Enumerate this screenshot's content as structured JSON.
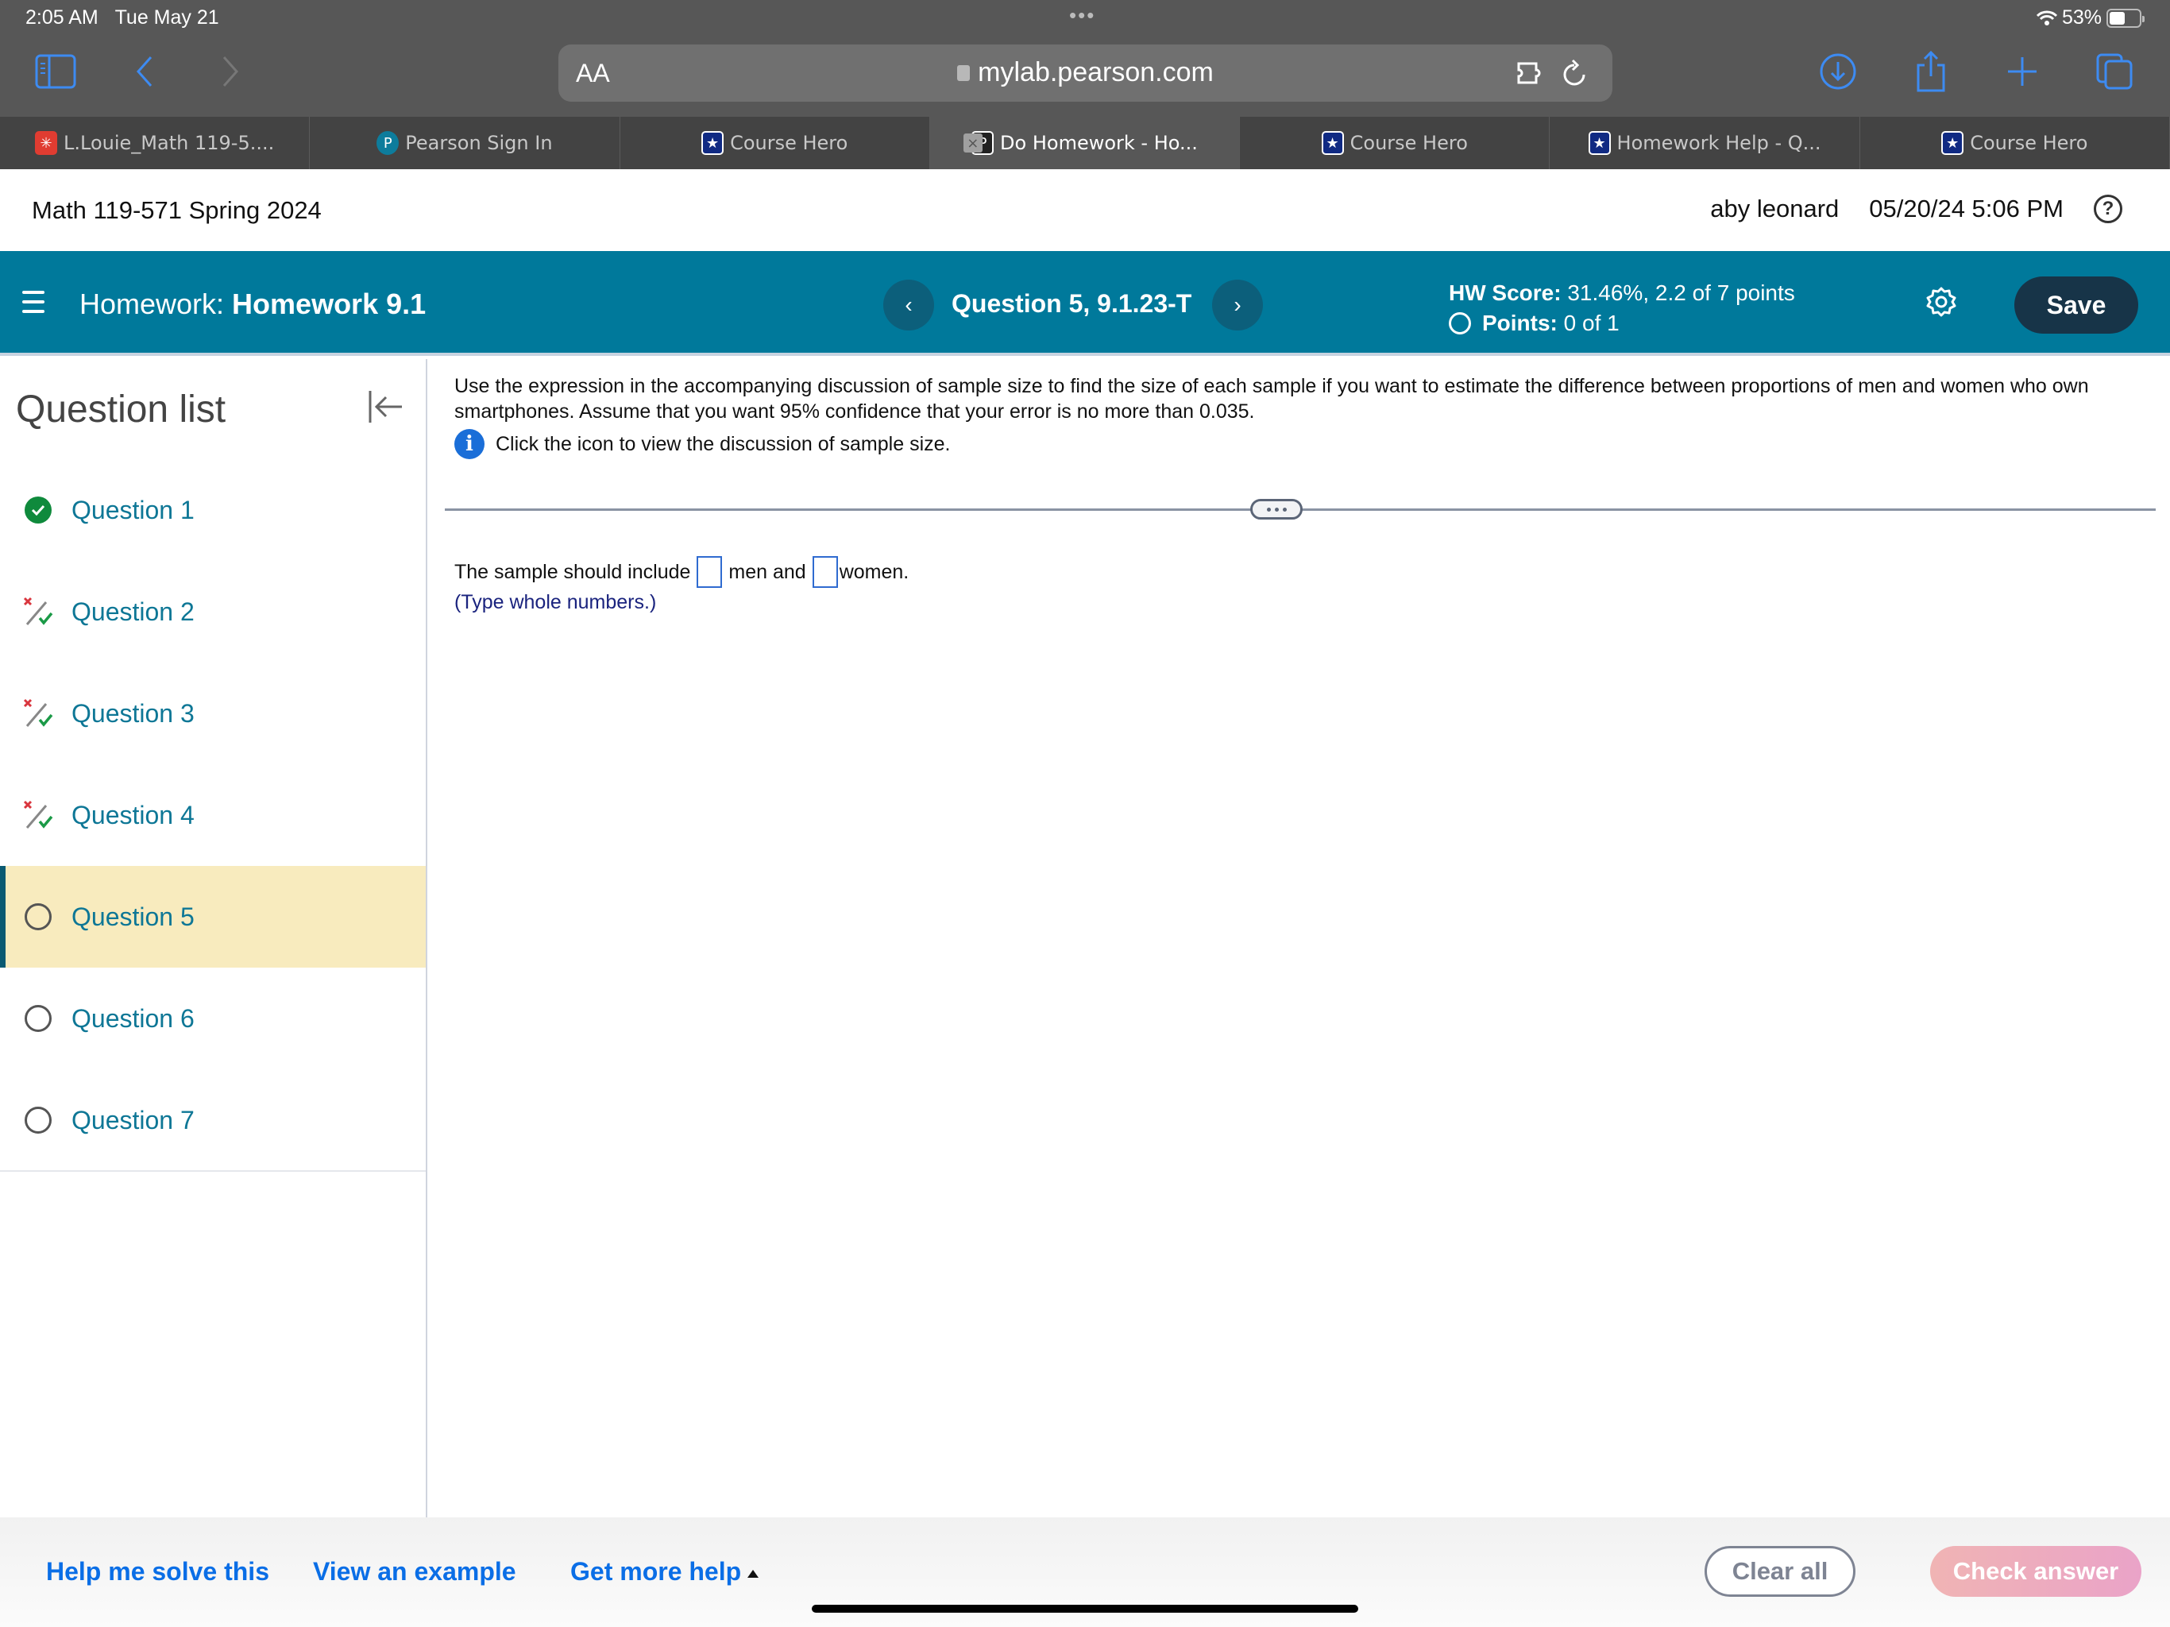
{
  "status_bar": {
    "time": "2:05 AM",
    "date": "Tue May 21",
    "battery": "53%",
    "battery_level": 0.53
  },
  "browser": {
    "text_size_label": "AA",
    "url": "mylab.pearson.com",
    "tabs": [
      {
        "label": "L.Louie_Math 119-5....",
        "icon": "canvas-icon",
        "active": false
      },
      {
        "label": "Pearson Sign In",
        "icon": "pearson-icon",
        "active": false
      },
      {
        "label": "Course Hero",
        "icon": "course-hero-icon",
        "active": false
      },
      {
        "label": "Do Homework - Ho...",
        "icon": "pearson-p-icon",
        "active": true
      },
      {
        "label": "Course Hero",
        "icon": "course-hero-icon",
        "active": false
      },
      {
        "label": "Homework Help - Q...",
        "icon": "course-hero-icon",
        "active": false
      },
      {
        "label": "Course Hero",
        "icon": "course-hero-icon",
        "active": false
      }
    ]
  },
  "course": {
    "title": "Math 119-571 Spring 2024",
    "user": "aby leonard",
    "datetime": "05/20/24 5:06 PM"
  },
  "hw_bar": {
    "prefix": "Homework:",
    "name": "Homework 9.1",
    "question_label": "Question 5, 9.1.23-T",
    "hw_score_label": "HW Score:",
    "hw_score_value": "31.46%, 2.2 of 7 points",
    "points_label": "Points:",
    "points_value": "0 of 1",
    "save_label": "Save"
  },
  "sidebar": {
    "title": "Question list",
    "items": [
      {
        "label": "Question 1",
        "status": "correct"
      },
      {
        "label": "Question 2",
        "status": "partial"
      },
      {
        "label": "Question 3",
        "status": "partial"
      },
      {
        "label": "Question 4",
        "status": "partial"
      },
      {
        "label": "Question 5",
        "status": "unanswered",
        "current": true
      },
      {
        "label": "Question 6",
        "status": "unanswered"
      },
      {
        "label": "Question 7",
        "status": "unanswered"
      }
    ]
  },
  "question": {
    "text": "Use the expression in the accompanying discussion of sample size to find the size of each sample if you want to estimate the difference between proportions of men and women who own smartphones. Assume that you want 95% confidence that your error is no more than 0.035.",
    "info_text": "Click the icon to view the discussion of sample size.",
    "answer_prefix": "The sample should include",
    "answer_mid": "men and",
    "answer_suffix": "women.",
    "men_value": "",
    "women_value": "",
    "hint": "(Type whole numbers.)"
  },
  "footer": {
    "help_me_solve": "Help me solve this",
    "view_example": "View an example",
    "get_more_help": "Get more help",
    "clear_all": "Clear all",
    "check_answer": "Check answer"
  },
  "colors": {
    "teal": "#00799b",
    "save_bg": "#173448",
    "link": "#0a6ee6",
    "current_row": "#f8ebbe"
  }
}
